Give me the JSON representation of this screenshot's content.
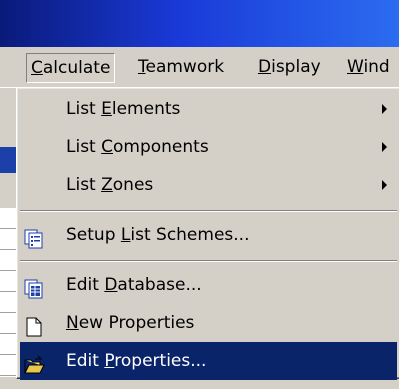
{
  "menubar": {
    "items": [
      {
        "label": "Calculate",
        "mnemonic": "C",
        "rest": "alculate",
        "active": true
      },
      {
        "label": "Teamwork",
        "mnemonic": "T",
        "rest": "eamwork"
      },
      {
        "label": "Display",
        "mnemonic": "D",
        "rest": "isplay"
      },
      {
        "label": "Wind",
        "mnemonic": "W",
        "rest": "ind"
      }
    ]
  },
  "menu": {
    "items": [
      {
        "pre": "List ",
        "mnemonic": "E",
        "post": "lements",
        "submenu": true
      },
      {
        "pre": "List ",
        "mnemonic": "C",
        "post": "omponents",
        "submenu": true
      },
      {
        "pre": "List ",
        "mnemonic": "Z",
        "post": "ones",
        "submenu": true
      },
      {
        "pre": "Setup ",
        "mnemonic": "L",
        "post": "ist Schemes...",
        "icon": "list-schemes-icon"
      },
      {
        "pre": "Edit ",
        "mnemonic": "D",
        "post": "atabase...",
        "icon": "database-icon"
      },
      {
        "pre": "",
        "mnemonic": "N",
        "post": "ew Properties",
        "icon": "new-document-icon"
      },
      {
        "pre": "Edit ",
        "mnemonic": "P",
        "post": "roperties...",
        "icon": "open-folder-icon",
        "selected": true
      }
    ]
  },
  "colors": {
    "menu_bg": "#d4d0c8",
    "highlight": "#0a246a",
    "title_bar": "#1a3ad8"
  }
}
